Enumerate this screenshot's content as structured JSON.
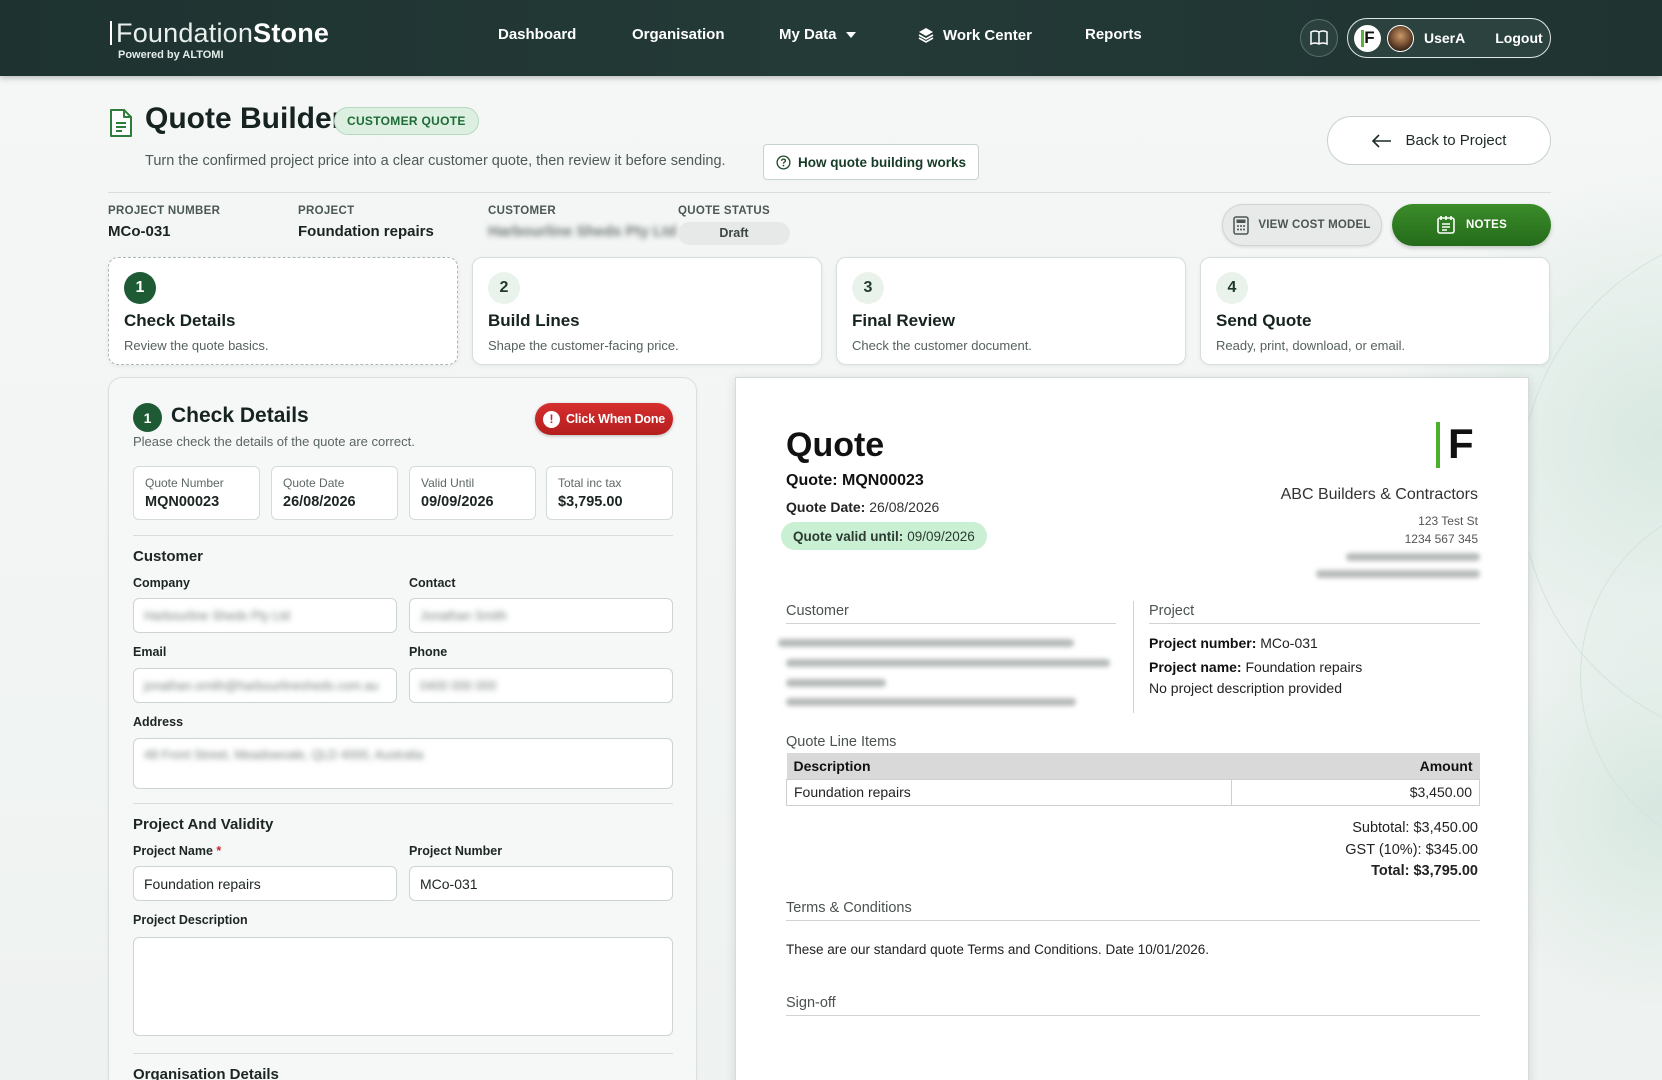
{
  "nav": {
    "brand_light": "Foundation",
    "brand_bold": "Stone",
    "brand_sub": "Powered by ALTOMI",
    "items": [
      "Dashboard",
      "Organisation",
      "My Data",
      "Work Center",
      "Reports"
    ],
    "user": "UserA",
    "logout": "Logout"
  },
  "header": {
    "title": "Quote Builder",
    "badge": "CUSTOMER QUOTE",
    "subtitle": "Turn the confirmed project price into a clear customer quote, then review it before sending.",
    "howto": "How quote building works",
    "back": "Back to Project"
  },
  "meta": {
    "project_number_label": "PROJECT NUMBER",
    "project_number": "MCo-031",
    "project_label": "PROJECT",
    "project": "Foundation repairs",
    "customer_label": "CUSTOMER",
    "customer": "Harbourline Sheds Pty Ltd",
    "status_label": "QUOTE STATUS",
    "status": "Draft",
    "cost_btn": "VIEW COST MODEL",
    "notes_btn": "NOTES"
  },
  "steps": [
    {
      "num": "1",
      "title": "Check Details",
      "desc": "Review the quote basics."
    },
    {
      "num": "2",
      "title": "Build Lines",
      "desc": "Shape the customer-facing price."
    },
    {
      "num": "3",
      "title": "Final Review",
      "desc": "Check the customer document."
    },
    {
      "num": "4",
      "title": "Send Quote",
      "desc": "Ready, print, download, or email."
    }
  ],
  "panel": {
    "num": "1",
    "title": "Check Details",
    "subtitle": "Please check the details of the quote are correct.",
    "done_btn": "Click When Done",
    "info": [
      {
        "label": "Quote Number",
        "value": "MQN00023"
      },
      {
        "label": "Quote Date",
        "value": "26/08/2026"
      },
      {
        "label": "Valid Until",
        "value": "09/09/2026"
      },
      {
        "label": "Total inc tax",
        "value": "$3,795.00"
      }
    ],
    "customer_title": "Customer",
    "company_label": "Company",
    "company_value": "Harbourline Sheds Pty Ltd",
    "contact_label": "Contact",
    "contact_value": "Jonathan Smith",
    "email_label": "Email",
    "email_value": "jonathan.smith@harbourlinesheds.com.au",
    "phone_label": "Phone",
    "phone_value": "0400 000 000",
    "address_label": "Address",
    "address_value": "48 Front Street, Meadowvale, QLD 4000, Australia",
    "project_title": "Project And Validity",
    "project_name_label": "Project Name",
    "project_name_value": "Foundation repairs",
    "project_number_label": "Project Number",
    "project_number_value": "MCo-031",
    "project_desc_label": "Project Description",
    "org_title": "Organisation Details"
  },
  "doc": {
    "title": "Quote",
    "quote_number": "Quote: MQN00023",
    "quote_date_label": "Quote Date:",
    "quote_date": "26/08/2026",
    "valid_label": "Quote valid until:",
    "valid_until": "09/09/2026",
    "logo_letter": "F",
    "company": "ABC Builders & Contractors",
    "addr1": "123 Test St",
    "addr2": "1234 567 345",
    "customer_title": "Customer",
    "project_title": "Project",
    "project_number_label": "Project number:",
    "project_number": "MCo-031",
    "project_name_label": "Project name:",
    "project_name": "Foundation repairs",
    "project_desc": "No project description provided",
    "lines_title": "Quote Line Items",
    "col_desc": "Description",
    "col_amount": "Amount",
    "lines": [
      {
        "description": "Foundation repairs",
        "amount": "$3,450.00"
      }
    ],
    "subtotal": "Subtotal: $3,450.00",
    "gst": "GST (10%): $345.00",
    "total": "Total: $3,795.00",
    "terms_title": "Terms & Conditions",
    "terms_text": "These are our standard quote Terms and Conditions. Date 10/01/2026.",
    "signoff_title": "Sign-off"
  }
}
